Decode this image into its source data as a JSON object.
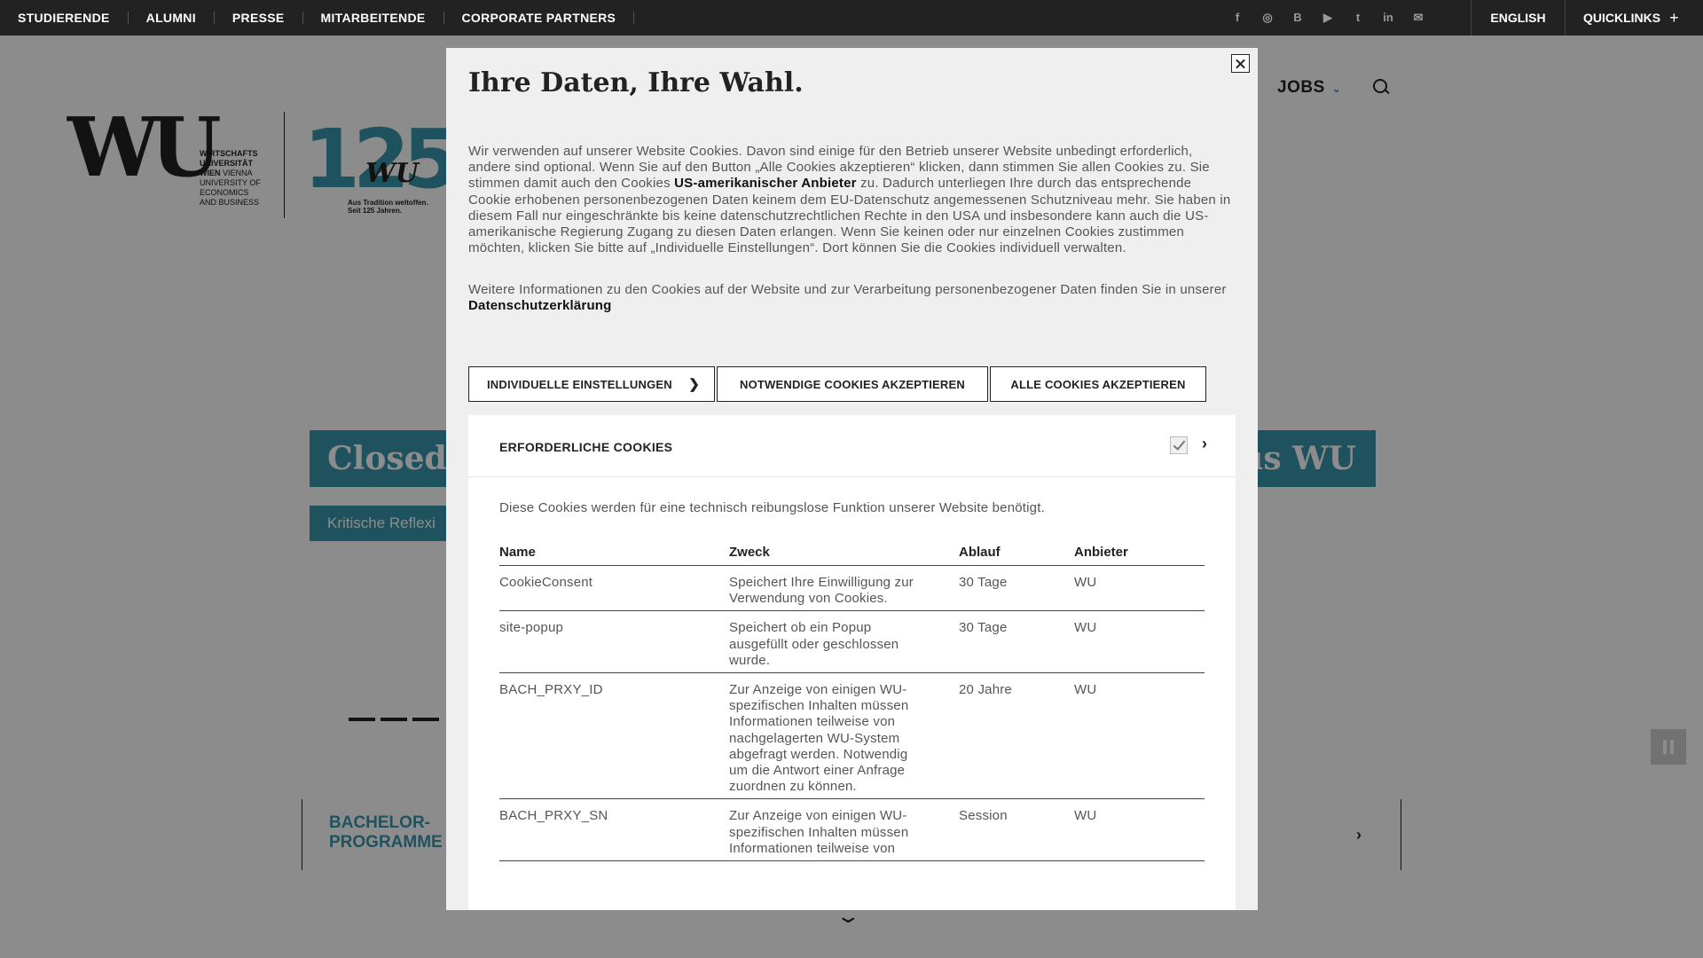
{
  "topbar": {
    "nav": [
      "STUDIERENDE",
      "ALUMNI",
      "PRESSE",
      "MITARBEITENDE",
      "CORPORATE PARTNERS"
    ],
    "social_icons": [
      "facebook-icon",
      "instagram-icon",
      "blog-icon",
      "youtube-icon",
      "twitter-icon",
      "linkedin-icon",
      "newsletter-icon"
    ],
    "social_glyphs": [
      "f",
      "◎",
      "B",
      "▶",
      "t",
      "in",
      "✉"
    ],
    "english": "ENGLISH",
    "quicklinks": "QUICKLINKS",
    "quicklinks_symbol": "+"
  },
  "header": {
    "logo_letters": "WU",
    "logo_line1": "WIRTSCHAFTS",
    "logo_line2": "UNIVERSITÄT",
    "logo_line3a": "WIEN",
    "logo_line3b": " VIENNA",
    "logo_line4": "UNIVERSITY OF",
    "logo_line5": "ECONOMICS",
    "logo_line6": "AND BUSINESS",
    "anniversary_number": "125",
    "anniversary_wu": "WU",
    "anniversary_tag1": "Aus Tradition weltoffen.",
    "anniversary_tag2": "Seit 125 Jahren.",
    "jobs": "JOBS"
  },
  "hero": {
    "title_left": "Closed",
    "title_right": "us WU",
    "subtitle": "Kritische Reflexi",
    "bachelor_line1": "BACHELOR-",
    "bachelor_line2": "PROGRAMME"
  },
  "modal": {
    "title": "Ihre Daten, Ihre Wahl.",
    "text_a": "Wir verwenden auf unserer Website Cookies. Davon sind einige für den Betrieb unserer Website unbedingt erforderlich, andere sind optional. Wenn Sie auf den Button „Alle Cookies akzeptieren“ klicken, dann stimmen Sie allen Cookies zu. Sie stimmen damit auch den Cookies ",
    "text_b": "US-amerikanischer Anbieter",
    "text_c": " zu. Dadurch unterliegen Ihre durch das entsprechende Cookie erhobenen personenbezogenen Daten keinem dem EU-Datenschutz angemessenen Schutzniveau mehr. Sie haben in diesem Fall nur eingeschränkte bis keine datenschutzrechtlichen Rechte in den USA und insbesondere kann auch die US-amerikanische Regierung Zugang zu diesen Daten erlangen. Wenn Sie keinen oder nur einzelnen Cookies zustimmen möchten, klicken Sie bitte auf „Individuelle Einstellungen“. Dort können Sie die Cookies individuell verwalten.",
    "text2_a": "Weitere Informationen zu den Cookies auf der Website und zur Verarbeitung personenbezogener Daten finden Sie in unserer ",
    "text2_link": "Datenschutzerklärung",
    "btn_individual": "INDIVIDUELLE EINSTELLUNGEN",
    "btn_necessary": "NOTWENDIGE COOKIES AKZEPTIEREN",
    "btn_all": "ALLE COOKIES AKZEPTIEREN",
    "section_label": "ERFORDERLICHE COOKIES",
    "section_desc": "Diese Cookies werden für eine technisch reibungslose Funktion unserer Website benötigt.",
    "table_headers": [
      "Name",
      "Zweck",
      "Ablauf",
      "Anbieter"
    ],
    "rows": [
      {
        "name": "CookieConsent",
        "purpose": "Speichert Ihre Einwilligung zur Verwendung von Cookies.",
        "expiry": "30 Tage",
        "provider": "WU"
      },
      {
        "name": "site-popup",
        "purpose": "Speichert ob ein Popup ausgefüllt oder geschlossen wurde.",
        "expiry": "30 Tage",
        "provider": "WU"
      },
      {
        "name": "BACH_PRXY_ID",
        "purpose": "Zur Anzeige von einigen WU-spezifischen Inhalten müssen Informationen teilweise von nachgelagerten WU-System abgefragt werden. Notwendig um die Antwort einer Anfrage zuordnen zu können.",
        "expiry": "20 Jahre",
        "provider": "WU"
      },
      {
        "name": "BACH_PRXY_SN",
        "purpose": "Zur Anzeige von einigen WU-spezifischen Inhalten müssen Informationen teilweise von",
        "expiry": "Session",
        "provider": "WU"
      }
    ]
  },
  "colors": {
    "accent": "#3a96ad",
    "topbar": "#222222",
    "modal_bg": "#efefef"
  }
}
